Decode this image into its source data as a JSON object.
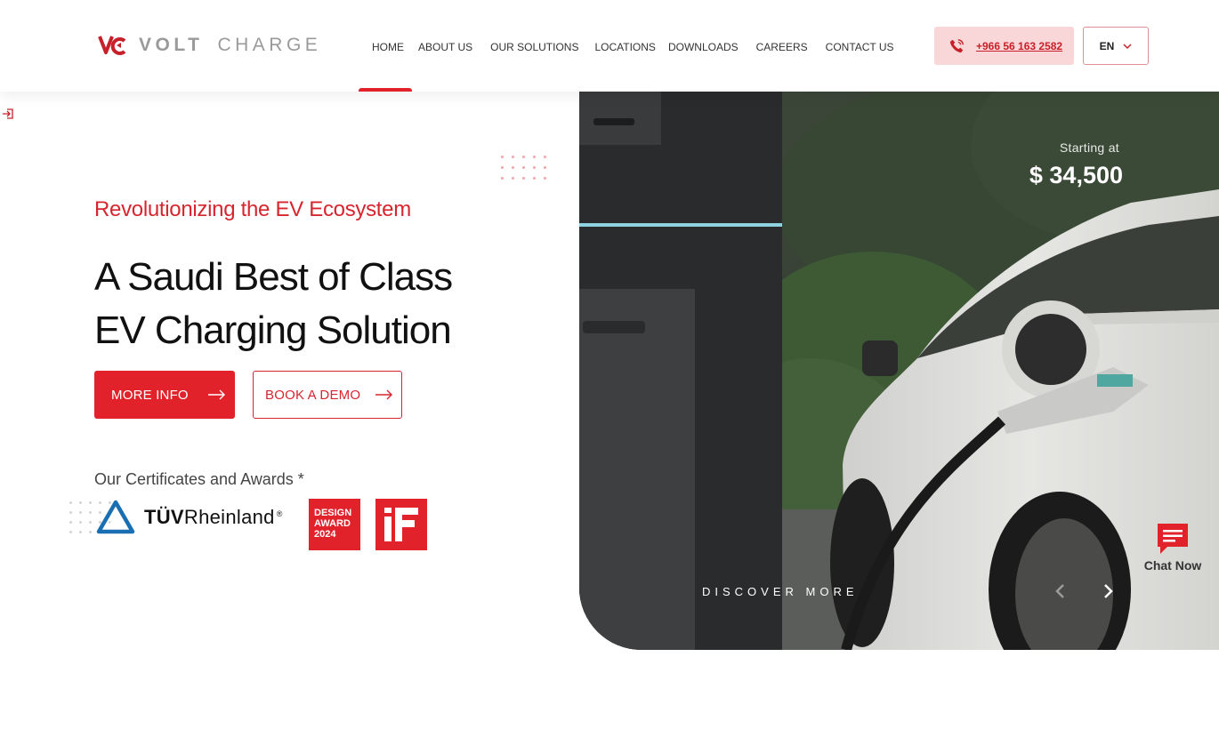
{
  "brand": {
    "word1": "VOLT",
    "word2": "CHARGE",
    "accent": "#e1222b"
  },
  "nav": {
    "items": [
      {
        "label": "HOME",
        "active": true
      },
      {
        "label": "ABOUT US",
        "active": false
      },
      {
        "label": "OUR SOLUTIONS",
        "active": false
      },
      {
        "label": "LOCATIONS",
        "active": false
      },
      {
        "label": "DOWNLOADS",
        "active": false
      },
      {
        "label": "CAREERS",
        "active": false
      },
      {
        "label": "CONTACT US",
        "active": false
      }
    ]
  },
  "header": {
    "phone": "+966 56 163 2582",
    "phone_icon": "phone-icon",
    "language": "EN"
  },
  "hero": {
    "subtitle": "Revolutionizing the EV Ecosystem",
    "headline_line1": "A Saudi Best of Class",
    "headline_line2": "EV Charging Solution",
    "more_info_label": "MORE INFO",
    "book_demo_label": "BOOK A DEMO",
    "certificates_title": "Our Certificates and Awards *",
    "tuv_prefix": "TÜV",
    "tuv_suffix": "Rheinland",
    "tuv_reg": "®",
    "award_lines": [
      "DESIGN",
      "AWARD",
      "2024"
    ]
  },
  "slide": {
    "price_label": "Starting at",
    "price_value": "$ 34,500",
    "discover_label": "DISCOVER MORE"
  },
  "chat": {
    "label": "Chat Now"
  }
}
